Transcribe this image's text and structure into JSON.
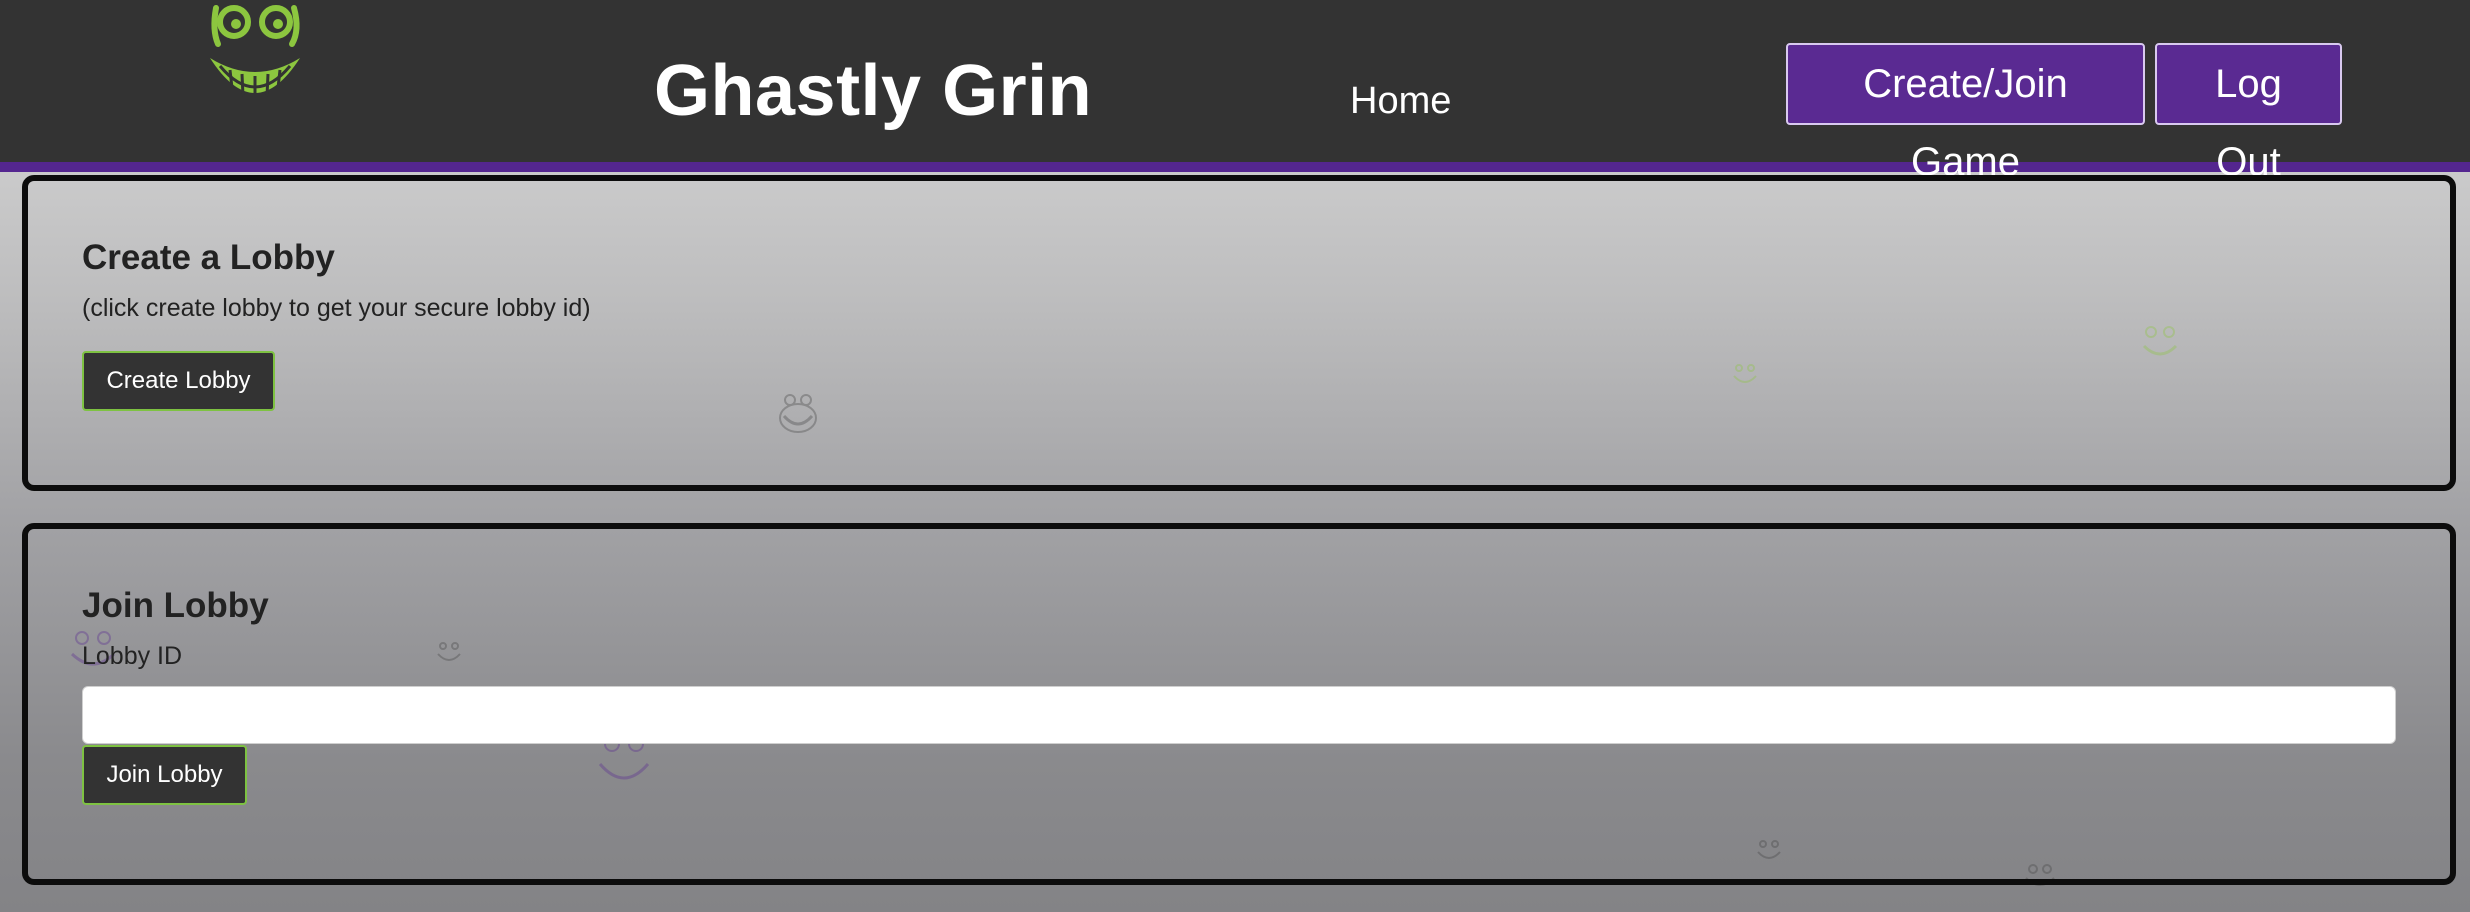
{
  "header": {
    "brand": "Ghastly Grin",
    "nav_home": "Home",
    "create_join_label": "Create/Join Game",
    "logout_label": "Log Out",
    "logo_icon": "grinning-face-logo-icon",
    "accent_color": "#54268f",
    "logo_color": "#8cc63f"
  },
  "create_panel": {
    "title": "Create a Lobby",
    "hint": "(click create lobby to get your secure lobby id)",
    "button_label": "Create Lobby"
  },
  "join_panel": {
    "title": "Join Lobby",
    "field_label": "Lobby ID",
    "input_value": "",
    "input_placeholder": "",
    "button_label": "Join Lobby"
  }
}
